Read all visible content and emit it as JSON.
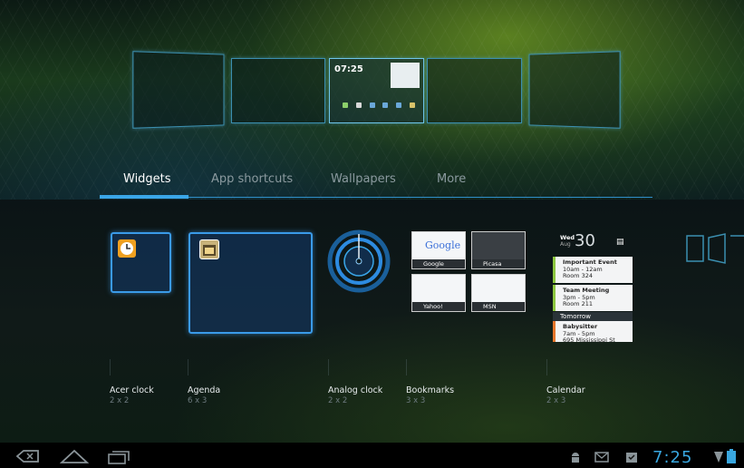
{
  "home_screen": {
    "mini_clock": "07:25"
  },
  "tabs": [
    {
      "label": "Widgets",
      "active": true
    },
    {
      "label": "App shortcuts",
      "active": false
    },
    {
      "label": "Wallpapers",
      "active": false
    },
    {
      "label": "More",
      "active": false
    }
  ],
  "widgets": [
    {
      "name": "Acer clock",
      "size": "2 x 2"
    },
    {
      "name": "Agenda",
      "size": "6 x 3"
    },
    {
      "name": "Analog clock",
      "size": "2 x 2"
    },
    {
      "name": "Bookmarks",
      "size": "3 x 3"
    },
    {
      "name": "Calendar",
      "size": "2 x 3"
    }
  ],
  "bookmarks_preview": {
    "logo": "Google",
    "captions": [
      "Google",
      "Picasa",
      "Yahoo!",
      "MSN"
    ]
  },
  "calendar_preview": {
    "day": "Wed",
    "month": "Aug",
    "date": "30",
    "events": [
      {
        "title": "Important Event",
        "time": "10am - 12am",
        "place": "Room 324",
        "color": "#8cc63f"
      },
      {
        "title": "Team Meeting",
        "time": "3pm - 5pm",
        "place": "Room 211",
        "color": "#8cc63f"
      }
    ],
    "tomorrow_label": "Tomorrow",
    "tomorrow_event": {
      "title": "Babysitter",
      "time": "7am - 5pm",
      "place": "695 Mississippi St",
      "color": "#e5762b"
    }
  },
  "status_bar": {
    "time": "7:25"
  },
  "colors": {
    "accent": "#3aa6e8",
    "clock": "#39a7e0"
  }
}
